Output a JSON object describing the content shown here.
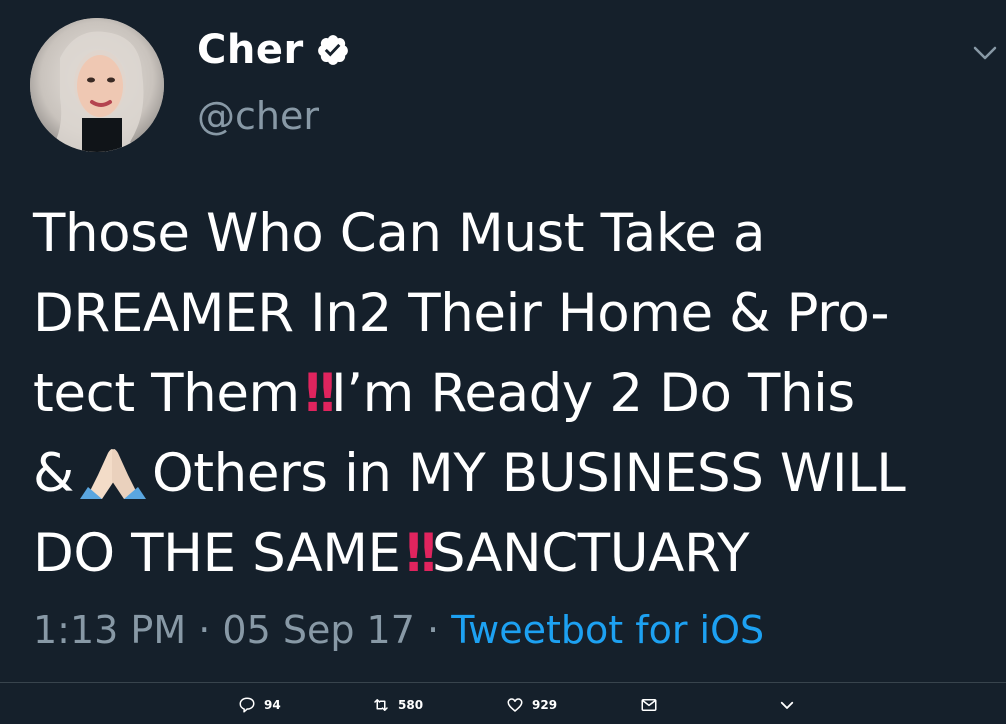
{
  "user": {
    "display_name": "Cher",
    "handle": "@cher"
  },
  "tweet": {
    "line1": "Those Who Can Must Take a",
    "line2": "DREAMER In2 Their Home & Pro-",
    "line3a": "tect Them",
    "line3b": "I’m Ready 2 Do This",
    "line4a": "&",
    "line4b": "Others in MY BUSINESS WILL",
    "line5a": "DO THE SAME",
    "line5b": "SANCTUARY",
    "emoji_bang": "‼",
    "emoji_pray": "folded-hands-icon"
  },
  "meta": {
    "time": "1:13 PM",
    "separator": "·",
    "date": "05 Sep 17",
    "source": "Tweetbot for iOS"
  },
  "actions": {
    "replies": "94",
    "retweets": "580",
    "likes": "929"
  },
  "colors": {
    "background": "#15202b",
    "text": "#ffffff",
    "muted": "#8899a6",
    "link": "#1da1f2",
    "emoji_red": "#e0245e"
  }
}
